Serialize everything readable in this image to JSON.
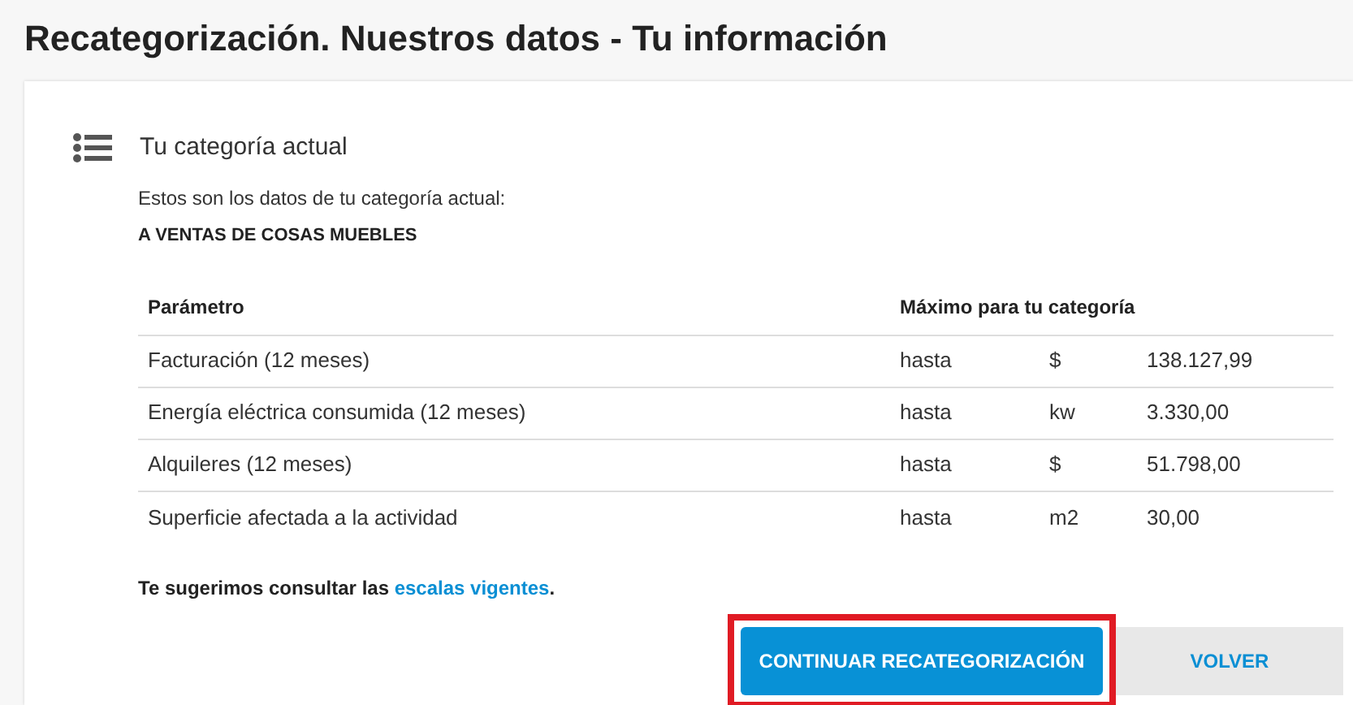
{
  "page_title": "Recategorización. Nuestros datos - Tu información",
  "section": {
    "title": "Tu categoría actual",
    "intro": "Estos son los datos de tu categoría actual:",
    "category": "A VENTAS DE COSAS MUEBLES"
  },
  "table": {
    "columns": [
      "Parámetro",
      "Máximo para tu categoría"
    ],
    "rows": [
      {
        "parameter": "Facturación (12 meses)",
        "qualifier": "hasta",
        "unit": "$",
        "value": "138.127,99"
      },
      {
        "parameter": "Energía eléctrica consumida (12 meses)",
        "qualifier": "hasta",
        "unit": "kw",
        "value": "3.330,00"
      },
      {
        "parameter": "Alquileres (12 meses)",
        "qualifier": "hasta",
        "unit": "$",
        "value": "51.798,00"
      },
      {
        "parameter": "Superficie afectada a la actividad",
        "qualifier": "hasta",
        "unit": "m2",
        "value": "30,00"
      }
    ]
  },
  "suggestion": {
    "before": "Te sugerimos consultar las ",
    "link": "escalas vigentes",
    "after": "."
  },
  "buttons": [
    {
      "label": "CONTINUAR RECATEGORIZACIÓN",
      "kind": "primary",
      "highlighted": true
    },
    {
      "label": "VOLVER",
      "kind": "secondary",
      "highlighted": false
    }
  ]
}
